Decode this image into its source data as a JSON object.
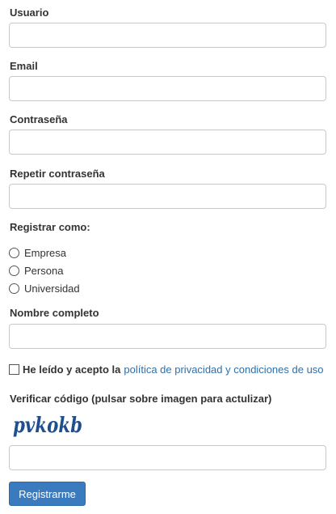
{
  "form": {
    "usuario_label": "Usuario",
    "usuario_value": "",
    "email_label": "Email",
    "email_value": "",
    "password_label": "Contraseña",
    "password_value": "",
    "repeat_password_label": "Repetir contraseña",
    "repeat_password_value": "",
    "register_as_label": "Registrar como:",
    "register_as_options": [
      "Empresa",
      "Persona",
      "Universidad"
    ],
    "fullname_label": "Nombre completo",
    "fullname_value": "",
    "terms_text": "He leído y acepto la",
    "terms_link": "política de privacidad y condiciones de uso",
    "verify_label": "Verificar código (pulsar sobre imagen para actulizar)",
    "captcha_text": "pvkokb",
    "captcha_value": "",
    "submit_label": "Registrarme"
  },
  "colors": {
    "link": "#2f6fa9",
    "button": "#3a7bbf",
    "captcha": "#1f4f8f"
  }
}
